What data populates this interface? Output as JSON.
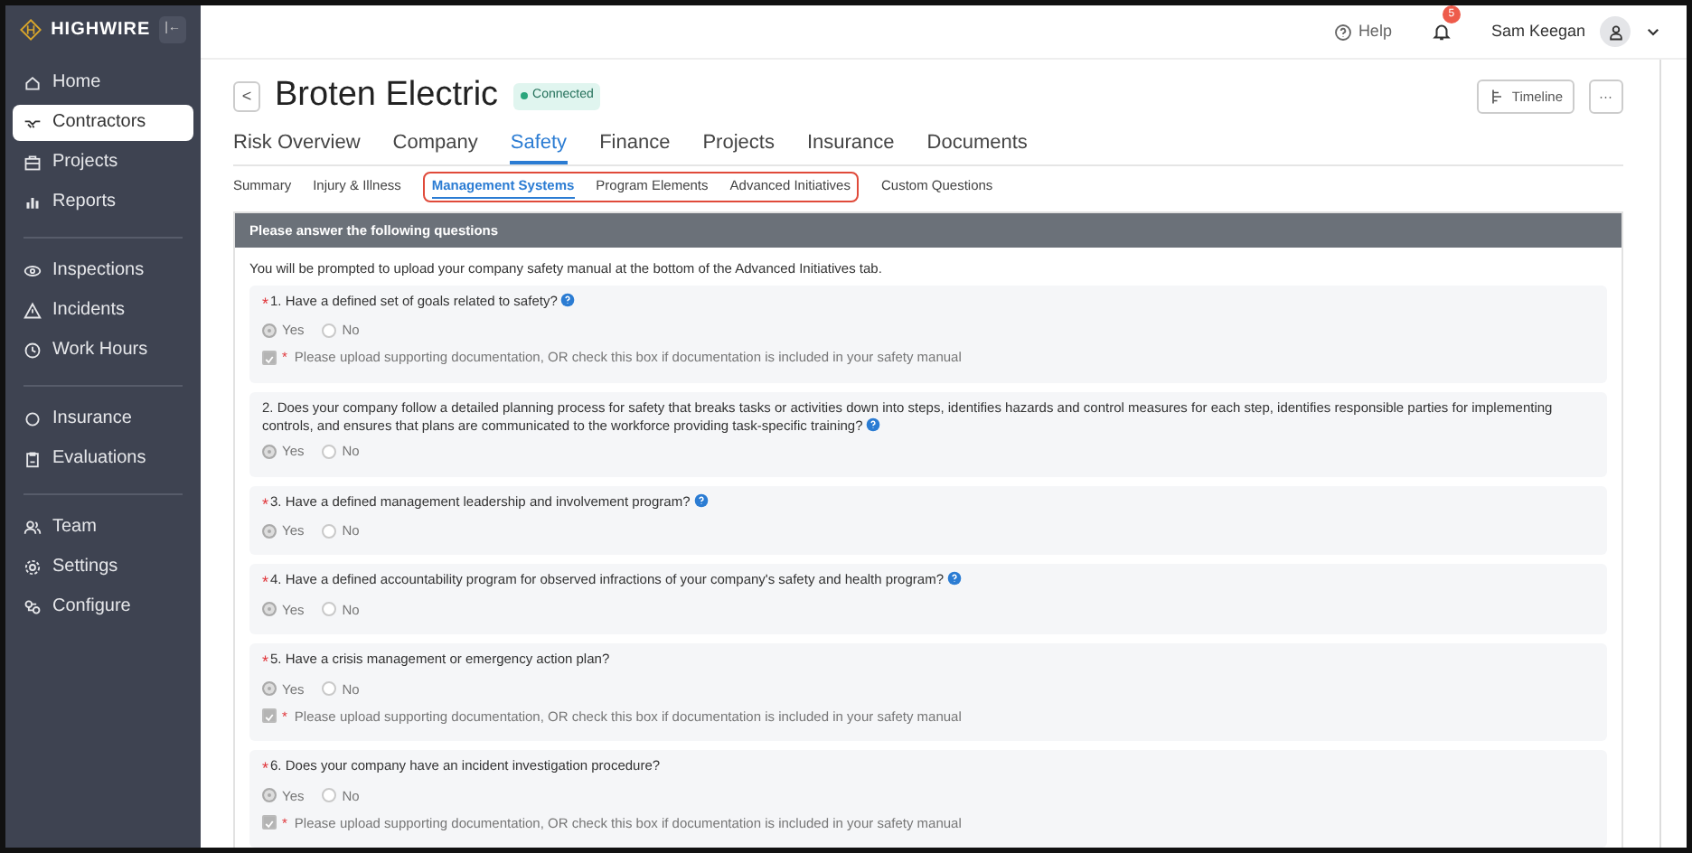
{
  "sidebar": {
    "logo": "HIGHWIRE",
    "collapse_button": "|←",
    "groups": [
      [
        {
          "label": "Home",
          "selected": false
        },
        {
          "label": "Contractors",
          "selected": true
        },
        {
          "label": "Projects",
          "selected": false
        },
        {
          "label": "Reports",
          "selected": false
        }
      ],
      [
        {
          "label": "Inspections",
          "selected": false
        },
        {
          "label": "Incidents",
          "selected": false
        },
        {
          "label": "Work Hours",
          "selected": false
        }
      ],
      [
        {
          "label": "Insurance",
          "selected": false
        },
        {
          "label": "Evaluations",
          "selected": false
        }
      ],
      [
        {
          "label": "Team",
          "selected": false
        },
        {
          "label": "Settings",
          "selected": false
        },
        {
          "label": "Configure",
          "selected": false
        }
      ]
    ]
  },
  "top_bar": {
    "help": "Help",
    "notification_count": "5",
    "user_name": "Sam Keegan"
  },
  "header": {
    "back": "<",
    "title": "Broten Electric",
    "status": "Connected",
    "timeline_button": "Timeline",
    "more_button": "···"
  },
  "tabs": [
    {
      "label": "Risk Overview",
      "selected": false
    },
    {
      "label": "Company",
      "selected": false
    },
    {
      "label": "Safety",
      "selected": true
    },
    {
      "label": "Finance",
      "selected": false
    },
    {
      "label": "Projects",
      "selected": false
    },
    {
      "label": "Insurance",
      "selected": false
    },
    {
      "label": "Documents",
      "selected": false
    }
  ],
  "sub_tabs": [
    {
      "kind": "tab",
      "label": "Summary",
      "selected": false
    },
    {
      "kind": "tab",
      "label": "Injury & Illness",
      "selected": false
    },
    {
      "kind": "highlight_group",
      "tabs": [
        {
          "label": "Management Systems",
          "selected": true
        },
        {
          "label": "Program Elements",
          "selected": false
        },
        {
          "label": "Advanced Initiatives",
          "selected": false
        }
      ]
    },
    {
      "kind": "tab",
      "label": "Custom Questions",
      "selected": false
    }
  ],
  "panel": {
    "title": "Please answer the following questions",
    "intro": "You will be prompted to upload your company safety manual at the bottom of the Advanced Initiatives tab.",
    "questions": [
      {
        "required_mark": "*",
        "text": "1. Have a defined set of goals related to safety?",
        "info": true,
        "options": [
          {
            "label": "Yes",
            "selected": true
          },
          {
            "label": "No",
            "selected": false
          }
        ],
        "document_check": {
          "required_mark": "*",
          "text": "Please upload supporting documentation, OR check this box if documentation is included in your safety manual",
          "checked": true
        }
      },
      {
        "text": "2. Does your company follow a detailed planning process for safety that breaks tasks or activities down into steps, identifies hazards and control measures for each step, identifies responsible parties for implementing controls, and ensures that plans are communicated to the workforce providing task-specific training?",
        "info": true,
        "options": [
          {
            "label": "Yes",
            "selected": true
          },
          {
            "label": "No",
            "selected": false
          }
        ]
      },
      {
        "required_mark": "*",
        "text": "3. Have a defined management leadership and involvement program?",
        "info": true,
        "options": [
          {
            "label": "Yes",
            "selected": true
          },
          {
            "label": "No",
            "selected": false
          }
        ]
      },
      {
        "required_mark": "*",
        "text": "4. Have a defined accountability program for observed infractions of your company's safety and health program?",
        "info": true,
        "options": [
          {
            "label": "Yes",
            "selected": true
          },
          {
            "label": "No",
            "selected": false
          }
        ]
      },
      {
        "required_mark": "*",
        "text": "5. Have a crisis management or emergency action plan?",
        "info": false,
        "options": [
          {
            "label": "Yes",
            "selected": true
          },
          {
            "label": "No",
            "selected": false
          }
        ],
        "document_check": {
          "required_mark": "*",
          "text": "Please upload supporting documentation, OR check this box if documentation is included in your safety manual",
          "checked": true
        }
      },
      {
        "required_mark": "*",
        "text": "6. Does your company have an incident investigation procedure?",
        "info": false,
        "options": [
          {
            "label": "Yes",
            "selected": true
          },
          {
            "label": "No",
            "selected": false
          }
        ],
        "document_check": {
          "required_mark": "*",
          "text": "Please upload supporting documentation, OR check this box if documentation is included in your safety manual",
          "checked": true
        }
      }
    ]
  }
}
